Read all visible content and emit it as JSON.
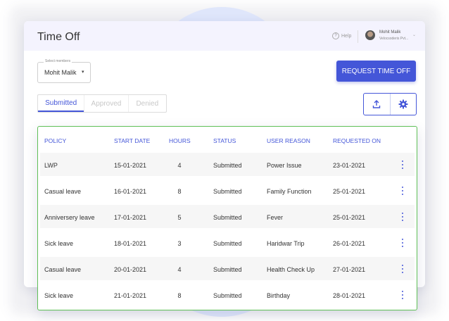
{
  "header": {
    "title": "Time Off",
    "help_label": "Help",
    "user_name": "Mohit Malik",
    "user_org": "Velocsoderis Pvt..."
  },
  "filters": {
    "select_legend": "Select members",
    "selected_member": "Mohit Malik"
  },
  "actions": {
    "request_label": "REQUEST TIME OFF"
  },
  "tabs": [
    {
      "label": "Submitted",
      "active": true
    },
    {
      "label": "Approved",
      "active": false
    },
    {
      "label": "Denied",
      "active": false
    }
  ],
  "toolbar_icons": [
    "upload-icon",
    "gear-icon"
  ],
  "table": {
    "columns": [
      "POLICY",
      "START DATE",
      "HOURS",
      "STATUS",
      "USER REASON",
      "REQUESTED ON"
    ],
    "rows": [
      [
        "LWP",
        "15-01-2021",
        "4",
        "Submitted",
        "Power Issue",
        "23-01-2021"
      ],
      [
        "Casual leave",
        "16-01-2021",
        "8",
        "Submitted",
        "Family Function",
        "25-01-2021"
      ],
      [
        "Anniversery leave",
        "17-01-2021",
        "5",
        "Submitted",
        "Fever",
        "25-01-2021"
      ],
      [
        "Sick leave",
        "18-01-2021",
        "3",
        "Submitted",
        "Haridwar Trip",
        "26-01-2021"
      ],
      [
        "Casual leave",
        "20-01-2021",
        "4",
        "Submitted",
        "Health Check Up",
        "27-01-2021"
      ],
      [
        "Sick leave",
        "21-01-2021",
        "8",
        "Submitted",
        "Birthday",
        "28-01-2021"
      ]
    ]
  },
  "colors": {
    "accent": "#4456d8",
    "header_bg": "#f4f3fe",
    "table_border": "#5fbf57",
    "backdrop_shape": "#dfe6fb"
  }
}
